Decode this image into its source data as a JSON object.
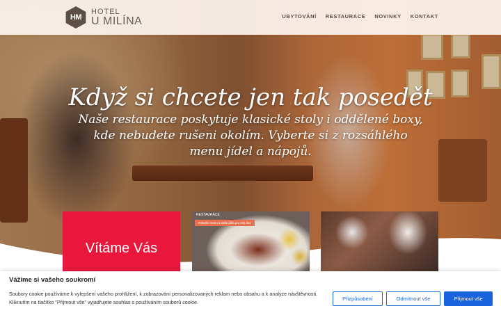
{
  "header": {
    "logo_mark": "HM",
    "logo_line1": "HOTEL",
    "logo_line2": "U MILÍNA",
    "nav": [
      "UBYTOVÁNÍ",
      "RESTAURACE",
      "NOVINKY",
      "KONTAKT"
    ]
  },
  "hero": {
    "title": "Když si chcete jen tak posedět",
    "text": "Naše restaurace poskytuje klasické stoly i oddělené boxy, kde nebudete rušeni okolím. Vyberte si z rozsáhlého menu jídel a nápojů."
  },
  "cards": {
    "welcome": "Vítáme Vás",
    "food_label": "RESTAURACE",
    "food_pill": "Polední menu a stálá jídla po celý den"
  },
  "cookie": {
    "title": "Vážíme si vašeho soukromí",
    "text": "Soubory cookie používáme k vylepšení vašeho prohlížení, k zobrazování personalizovaných reklam nebo obsahu a k analýze návštěvnosti. Kliknutím na tlačítko \"Přijmout vše\" vyjadřujete souhlas s používáním souborů cookie.",
    "btn_customize": "Přizpůsobení",
    "btn_reject": "Odmítnout vše",
    "btn_accept": "Přijmout vše"
  },
  "colors": {
    "accent_red": "#e8173b",
    "button_blue": "#1863dc"
  }
}
